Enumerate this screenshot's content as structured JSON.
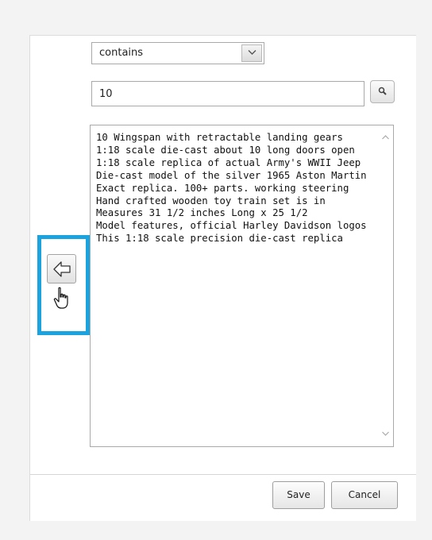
{
  "filter": {
    "operator": "contains",
    "search_value": "10"
  },
  "list": {
    "items": [
      "10 Wingspan with retractable landing gears",
      "1:18 scale die-cast about 10 long doors open",
      "1:18 scale replica of actual Army's WWII Jeep",
      "Die-cast model of the silver 1965 Aston Martin",
      "Exact replica. 100+ parts. working steering",
      "Hand crafted wooden toy train set is in",
      "Measures 31 1/2 inches Long x 25 1/2",
      "Model features, official Harley Davidson logos",
      "This 1:18 scale precision die-cast replica"
    ]
  },
  "footer": {
    "save_label": "Save",
    "cancel_label": "Cancel"
  },
  "colors": {
    "highlight": "#1aa3df"
  }
}
